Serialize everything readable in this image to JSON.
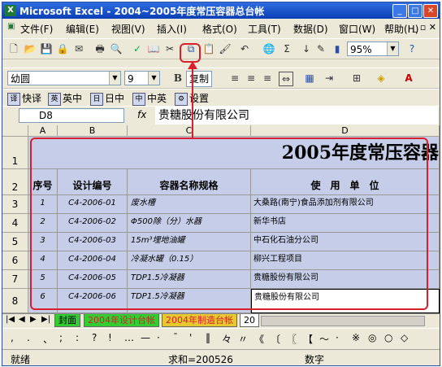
{
  "window": {
    "title": "Microsoft Excel - 2004~2005年度常压容器总台帐",
    "app_icon": "excel-icon"
  },
  "menu": [
    "文件(F)",
    "编辑(E)",
    "视图(V)",
    "插入(I)",
    "格式(O)",
    "工具(T)",
    "数据(D)",
    "窗口(W)",
    "帮助(H)"
  ],
  "toolbar": {
    "zoom": "95%"
  },
  "format_toolbar": {
    "font": "幼圆",
    "size": "9",
    "bold": "B",
    "copy_label": "复制"
  },
  "translate_toolbar": [
    "快译",
    "英中",
    "日中",
    "中英",
    "设置"
  ],
  "formula_bar": {
    "name_box": "D8",
    "fx": "fx",
    "content": "贵糖股份有限公司"
  },
  "grid": {
    "columns": [
      "A",
      "B",
      "C",
      "D"
    ],
    "rows": [
      "1",
      "2",
      "3",
      "4",
      "5",
      "6",
      "7",
      "8"
    ],
    "title": "2005年度常压容器",
    "headers": [
      "序号",
      "设计编号",
      "容器名称规格",
      "使　用　单　位"
    ],
    "data": [
      [
        "1",
        "C4-2006-01",
        "废水槽",
        "大桑路(南宁)食品添加剂有限公司"
      ],
      [
        "2",
        "C4-2006-02",
        "Φ500除（分）水器",
        "新华书店"
      ],
      [
        "3",
        "C4-2006-03",
        "15m³埋地油罐",
        "中石化石油分公司"
      ],
      [
        "4",
        "C4-2006-04",
        "冷凝水罐（0.15）",
        "柳兴工程项目"
      ],
      [
        "5",
        "C4-2006-05",
        "TDP1.5冷凝器",
        "贵糖股份有限公司"
      ],
      [
        "6",
        "C4-2006-06",
        "TDP1.5冷凝器",
        "贵糖股份有限公司"
      ]
    ]
  },
  "sheet_tabs": [
    "封面",
    "2004年设计台帐",
    "2004年制造台帐",
    "20"
  ],
  "symbols": [
    ",",
    ".",
    "、",
    ";",
    ":",
    "?",
    "!",
    "…",
    "—",
    "·",
    "ˉ",
    "'",
    "‖",
    "々",
    "〃",
    "《",
    "〔",
    "〖",
    "【",
    "～",
    "·",
    "※",
    "◎",
    "○",
    "◇"
  ],
  "status": {
    "mode": "就绪",
    "sum": "求和=200526",
    "numlock": "数字"
  }
}
